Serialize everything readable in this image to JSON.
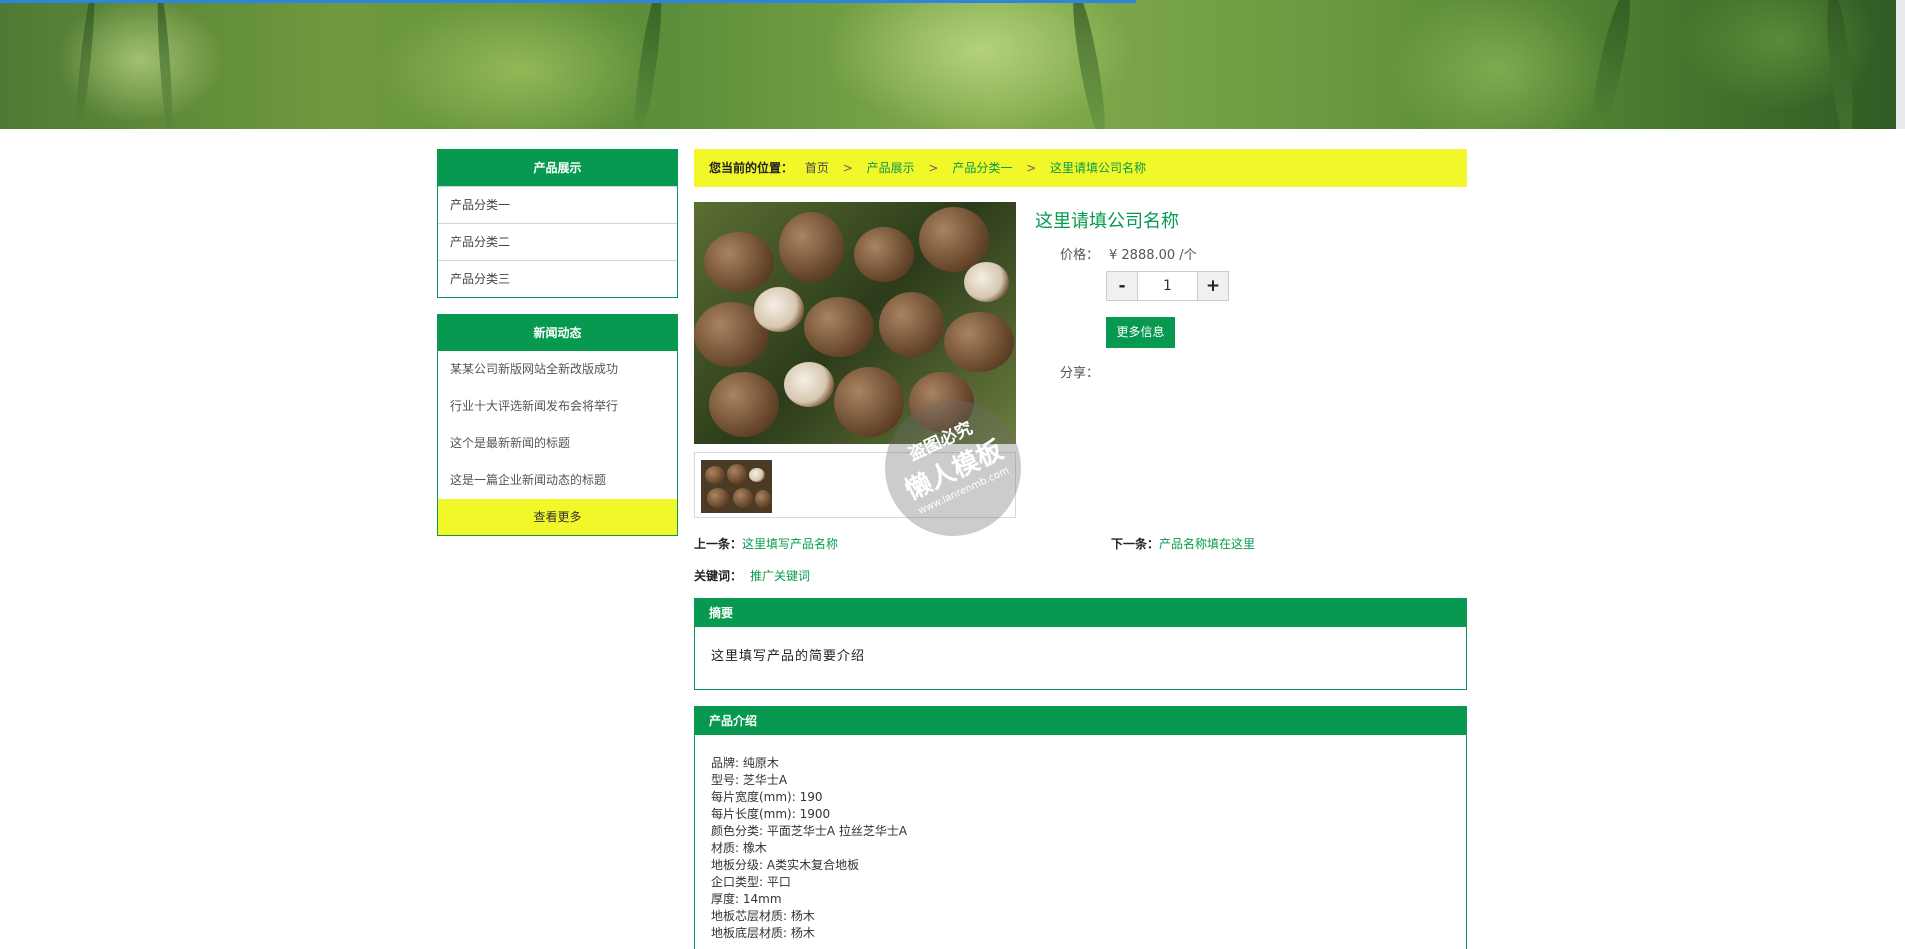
{
  "sidebar": {
    "products": {
      "title": "产品展示",
      "items": [
        "产品分类一",
        "产品分类二",
        "产品分类三"
      ]
    },
    "news": {
      "title": "新闻动态",
      "items": [
        "某某公司新版网站全新改版成功",
        "行业十大评选新闻发布会将举行",
        "这个是最新新闻的标题",
        "这是一篇企业新闻动态的标题"
      ],
      "more": "查看更多"
    }
  },
  "breadcrumb": {
    "lead": "您当前的位置：",
    "home": "首页",
    "sep": ">",
    "level1": "产品展示",
    "level2": "产品分类一",
    "current": "这里请填公司名称"
  },
  "watermark": {
    "line1": "盗图必究",
    "line2": "懒人模板",
    "line3": "www.lanrenmb.com"
  },
  "product": {
    "title": "这里请填公司名称",
    "price_label": "价格：",
    "price": "¥ 2888.00 /个",
    "qty_minus": "-",
    "qty": "1",
    "qty_plus": "+",
    "more_button": "更多信息",
    "share_label": "分享："
  },
  "nav": {
    "prev_label": "上一条：",
    "prev_link": "这里填写产品名称",
    "next_label": "下一条：",
    "next_link": "产品名称填在这里"
  },
  "keywords": {
    "label": "关键词：",
    "value": "推广关键词"
  },
  "summary": {
    "title": "摘要",
    "text": "这里填写产品的简要介绍"
  },
  "intro": {
    "title": "产品介绍",
    "specs": [
      "品牌: 纯原木",
      "型号: 芝华士A",
      "每片宽度(mm): 190",
      "每片长度(mm): 1900",
      "颜色分类: 平面芝华士A 拉丝芝华士A",
      "材质: 橡木",
      "地板分级: A类实木复合地板",
      "企口类型: 平口",
      "厚度: 14mm",
      "地板芯层材质: 杨木",
      "地板底层材质: 杨木"
    ]
  }
}
